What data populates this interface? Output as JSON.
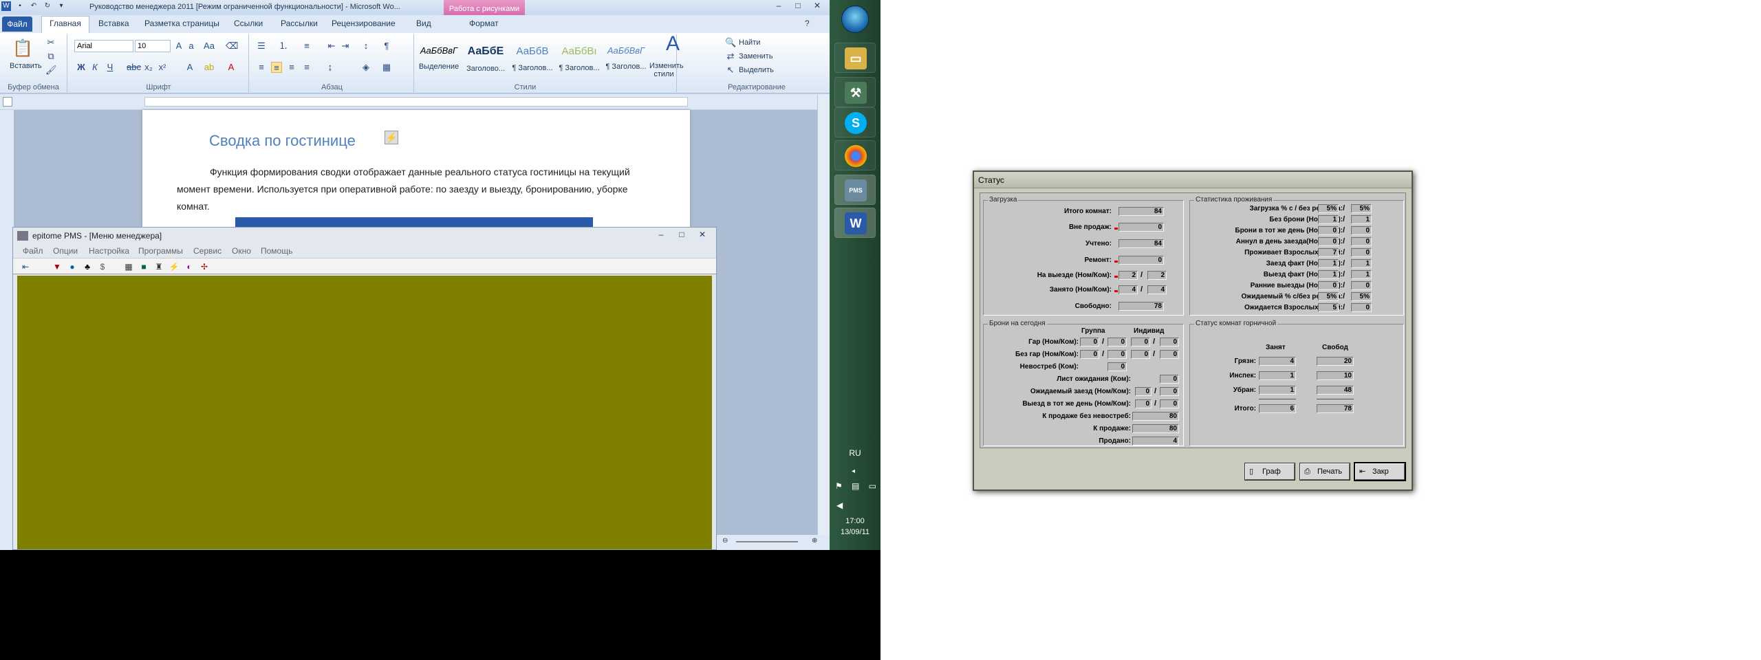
{
  "word": {
    "title": "Руководство менеджера 2011 [Режим ограниченной функциональности] - Microsoft Wo...",
    "context_tab": "Работа с рисунками",
    "tabs": [
      "Файл",
      "Главная",
      "Вставка",
      "Разметка страницы",
      "Ссылки",
      "Рассылки",
      "Рецензирование",
      "Вид",
      "Формат"
    ],
    "ribbon": {
      "clipboard_label": "Буфер обмена",
      "paste_label": "Вставить",
      "font_label": "Шрифт",
      "font_name": "Arial",
      "font_size": "10",
      "paragraph_label": "Абзац",
      "styles_label": "Стили",
      "editing_label": "Редактирование",
      "change_styles": "Изменить стили",
      "find": "Найти",
      "replace": "Заменить",
      "select": "Выделить",
      "styles": [
        {
          "sample": "АаБбВвГ",
          "name": "Выделение"
        },
        {
          "sample": "АаБбЕ",
          "name": "Заголово..."
        },
        {
          "sample": "АаБбВ",
          "name": "¶ Заголов..."
        },
        {
          "sample": "АаБбВı",
          "name": "¶ Заголов..."
        },
        {
          "sample": "АаБбВвГ",
          "name": "¶ Заголов..."
        }
      ]
    },
    "doc_heading": "Сводка по гостинице",
    "doc_paragraph": "Функция формирования сводки отображает данные реального статуса гостиницы на текущий момент времени. Используется при оперативной работе: по заезду и выезду, бронированию, уборке комнат.",
    "zoom": "%"
  },
  "pms": {
    "title": "epitome PMS - [Меню менеджера]",
    "menu": [
      "Файл",
      "Опции",
      "Настройка",
      "Программы",
      "Сервис",
      "Окно",
      "Помощь"
    ],
    "client_color": "#808000"
  },
  "taskbar": {
    "lang": "RU",
    "time": "17:00",
    "date": "13/09/11"
  },
  "status_dialog": {
    "title": "Статус",
    "load": {
      "title": "Загрузка",
      "rows": [
        {
          "label": "Итого комнат:",
          "value": "84"
        },
        {
          "label": "Вне продаж:",
          "value": "0"
        },
        {
          "label": "Учтено:",
          "value": "84"
        },
        {
          "label": "Ремонт:",
          "value": "0"
        },
        {
          "label": "На выезде (Ном/Ком):",
          "v1": "2",
          "v2": "2"
        },
        {
          "label": "Занято (Ном/Ком):",
          "v1": "4",
          "v2": "4"
        },
        {
          "label": "Свободно:",
          "value": "78"
        }
      ]
    },
    "stats": {
      "title": "Статистика проживания",
      "rows": [
        {
          "label": "Загрузка % с / без ремонта:",
          "v1": "5%",
          "v2": "5%"
        },
        {
          "label": "Без брони (Ном/Ком):",
          "v1": "1",
          "v2": "1"
        },
        {
          "label": "Брони в тот же день (Ном/Ком):",
          "v1": "0",
          "v2": "0"
        },
        {
          "label": "Аннул в день заезда(Ном/Ком):",
          "v1": "0",
          "v2": "0"
        },
        {
          "label": "Проживает Взрослых/Детей:",
          "v1": "7",
          "v2": "0"
        },
        {
          "label": "Заезд факт (Ном/Ком):",
          "v1": "1",
          "v2": "1"
        },
        {
          "label": "Выезд факт (Ном/Ком):",
          "v1": "1",
          "v2": "1"
        },
        {
          "label": "Ранние выезды (Ном/Ком):",
          "v1": "0",
          "v2": "0"
        },
        {
          "label": "Ожидаемый % с/без ремонта:",
          "v1": "5%",
          "v2": "5%"
        },
        {
          "label": "Ожидается Взрослых/Детей:",
          "v1": "5",
          "v2": "0"
        }
      ]
    },
    "bookings": {
      "title": "Брони на сегодня",
      "col_group": "Группа",
      "col_indiv": "Индивид",
      "gar": {
        "label": "Гар (Ном/Ком):",
        "g1": "0",
        "g2": "0",
        "i1": "0",
        "i2": "0"
      },
      "nogar": {
        "label": "Без гар (Ном/Ком):",
        "g1": "0",
        "g2": "0",
        "i1": "0",
        "i2": "0"
      },
      "noshow": {
        "label": "Невострeб (Ком):",
        "value": "0"
      },
      "waitlist": {
        "label": "Лист ожидания (Ком):",
        "value": "0"
      },
      "expected_arr": {
        "label": "Ожидаемый заезд (Ном/Ком):",
        "v1": "0",
        "v2": "0"
      },
      "sameday_dep": {
        "label": "Выезд в тот же день (Ном/Ком):",
        "v1": "0",
        "v2": "0"
      },
      "forsale_noshow": {
        "label": "К продаже без невостреб:",
        "value": "80"
      },
      "forsale": {
        "label": "К продаже:",
        "value": "80"
      },
      "sold": {
        "label": "Продано:",
        "value": "4"
      }
    },
    "housekeeping": {
      "title": "Статус комнат горничной",
      "col_occ": "Занят",
      "col_free": "Свобод",
      "rows": [
        {
          "label": "Грязн:",
          "occ": "4",
          "free": "20"
        },
        {
          "label": "Инспек:",
          "occ": "1",
          "free": "10"
        },
        {
          "label": "Убран:",
          "occ": "1",
          "free": "48"
        },
        {
          "label": "Итого:",
          "occ": "6",
          "free": "78"
        }
      ]
    },
    "buttons": {
      "graph": "Граф",
      "print": "Печать",
      "close": "Закр"
    }
  }
}
